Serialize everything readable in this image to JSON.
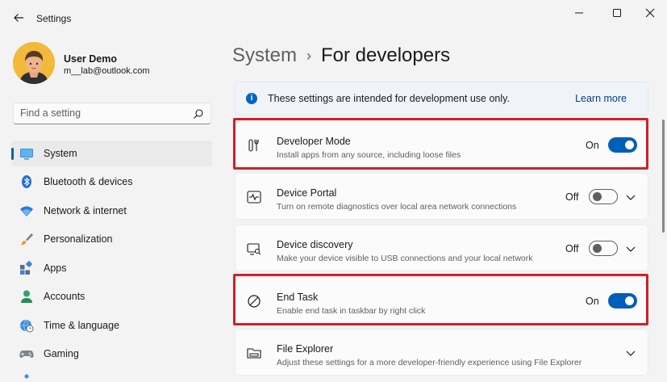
{
  "window": {
    "title": "Settings",
    "back_icon": "arrow-left-icon",
    "controls": [
      "minimize-icon",
      "maximize-icon",
      "close-icon"
    ]
  },
  "profile": {
    "name": "User Demo",
    "email": "m__lab@outlook.com"
  },
  "search": {
    "placeholder": "Find a setting"
  },
  "nav": {
    "items": [
      {
        "label": "System",
        "icon": "monitor-icon",
        "selected": true
      },
      {
        "label": "Bluetooth & devices",
        "icon": "bluetooth-icon"
      },
      {
        "label": "Network & internet",
        "icon": "wifi-icon"
      },
      {
        "label": "Personalization",
        "icon": "brush-icon"
      },
      {
        "label": "Apps",
        "icon": "apps-icon"
      },
      {
        "label": "Accounts",
        "icon": "person-icon"
      },
      {
        "label": "Time & language",
        "icon": "globe-clock-icon"
      },
      {
        "label": "Gaming",
        "icon": "gamepad-icon"
      }
    ]
  },
  "header": {
    "parent": "System",
    "separator": "›",
    "current": "For developers"
  },
  "info_banner": {
    "icon": "info-icon",
    "text": "These settings are intended for development use only.",
    "link": "Learn more"
  },
  "settings": [
    {
      "title": "Developer Mode",
      "description": "Install apps from any source, including loose files",
      "state": "On",
      "toggle": true,
      "expandable": false,
      "highlighted": true,
      "icon": "developer-tools-icon"
    },
    {
      "title": "Device Portal",
      "description": "Turn on remote diagnostics over local area network connections",
      "state": "Off",
      "toggle": true,
      "expandable": true,
      "highlighted": false,
      "icon": "pulse-monitor-icon"
    },
    {
      "title": "Device discovery",
      "description": "Make your device visible to USB connections and your local network",
      "state": "Off",
      "toggle": true,
      "expandable": true,
      "highlighted": false,
      "icon": "device-search-icon"
    },
    {
      "title": "End Task",
      "description": "Enable end task in taskbar by right click",
      "state": "On",
      "toggle": true,
      "expandable": false,
      "highlighted": true,
      "icon": "block-icon"
    },
    {
      "title": "File Explorer",
      "description": "Adjust these settings for a more developer-friendly experience using File Explorer",
      "state": "",
      "toggle": false,
      "expandable": true,
      "highlighted": false,
      "icon": "folder-drive-icon"
    }
  ],
  "colors": {
    "accent": "#005fb8",
    "highlight_border": "#d0202a",
    "background": "#f3f3f3",
    "card": "#fbfbfb"
  }
}
